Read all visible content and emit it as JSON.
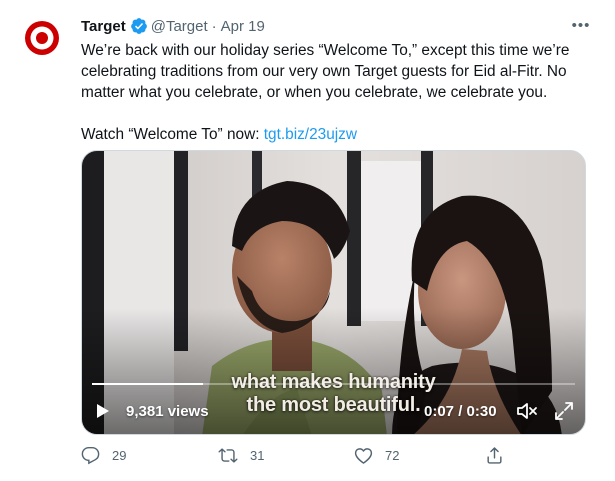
{
  "tweet": {
    "author_name": "Target",
    "handle": "@Target",
    "separator": "·",
    "date": "Apr 19",
    "more_label": "•••",
    "text_line1": "We’re back with our holiday series “Welcome To,” except this time we’re celebrating traditions from our very own Target guests for Eid al-Fitr. No matter what you celebrate, or when you celebrate, we celebrate you.",
    "watch_prefix": "Watch “Welcome To” now: ",
    "watch_link": "tgt.biz/23ujzw"
  },
  "video": {
    "caption_line1": "what makes humanity",
    "caption_line2": "the most beautiful.",
    "views": "9,381 views",
    "time": "0:07 / 0:30",
    "progress_fraction": 0.23
  },
  "actions": {
    "reply_count": "29",
    "retweet_count": "31",
    "like_count": "72"
  },
  "colors": {
    "brand_red": "#cc0000",
    "verified_blue": "#1d9bf0",
    "link": "#1d9bf0",
    "meta_gray": "#536471"
  },
  "icons": [
    "target-logo-icon",
    "verified-badge-icon",
    "more-icon",
    "play-icon",
    "mute-icon",
    "expand-icon",
    "reply-icon",
    "retweet-icon",
    "like-icon",
    "share-icon"
  ]
}
